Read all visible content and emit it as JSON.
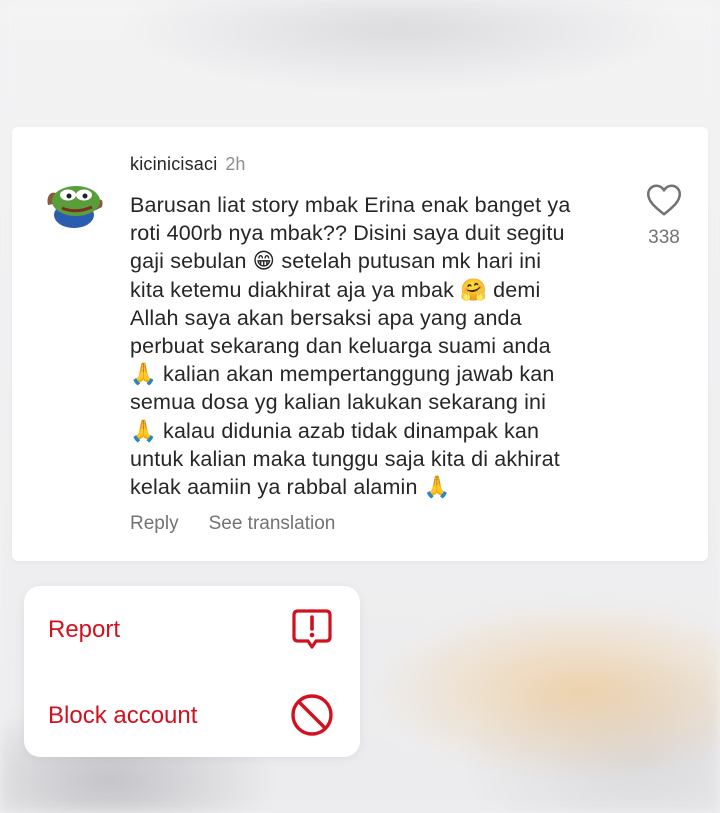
{
  "comment": {
    "username": "kicinicisaci",
    "time": "2h",
    "text": "Barusan liat story mbak Erina enak banget ya\nroti 400rb nya mbak?? Disini saya duit segitu\ngaji sebulan 😁 setelah putusan mk hari ini\nkita ketemu diakhirat aja ya mbak 🤗 demi\nAllah saya akan bersaksi apa yang anda\nperbuat sekarang dan keluarga suami anda\n🙏 kalian akan mempertanggung jawab kan\nsemua dosa yg kalian lakukan sekarang ini\n🙏 kalau didunia azab tidak dinampak kan\nuntuk kalian maka tunggu saja kita di akhirat\nkelak aamiin ya rabbal alamin 🙏",
    "like_count": "338",
    "reply_label": "Reply",
    "translate_label": "See translation"
  },
  "menu": {
    "items": [
      {
        "label": "Report",
        "icon": "report-icon"
      },
      {
        "label": "Block account",
        "icon": "block-icon"
      }
    ]
  },
  "colors": {
    "danger": "#d2101e",
    "text": "#262626",
    "secondary": "#737373",
    "muted": "#8e8e8e"
  }
}
